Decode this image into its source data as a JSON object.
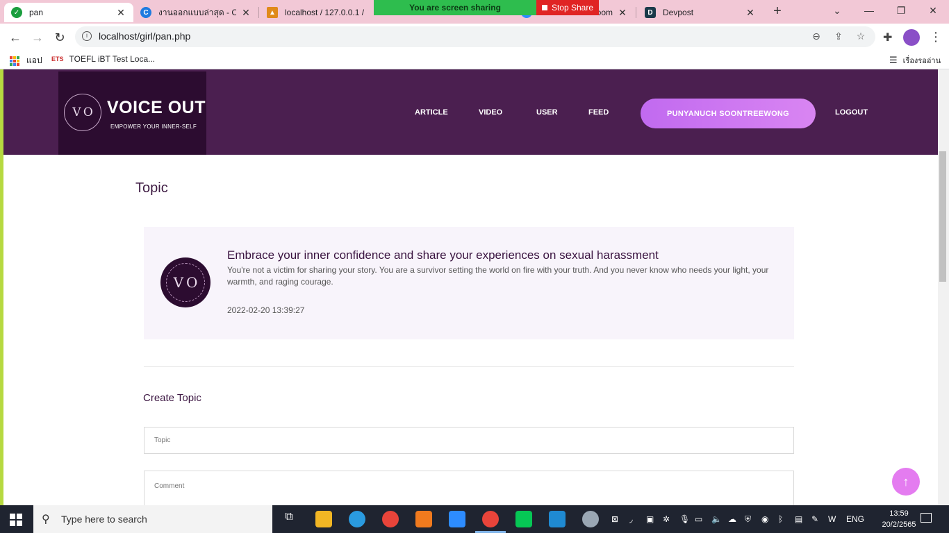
{
  "browser": {
    "tabs": [
      {
        "title": "pan",
        "favicon_color": "#1a9e3e",
        "active": true
      },
      {
        "title": "งานออกแบบล่าสุด - Canva",
        "favicon_color": "#1e7be0",
        "active": false
      },
      {
        "title": "localhost / 127.0.0.1 /",
        "favicon_color": "#e08a1a",
        "active": false
      },
      {
        "title": "",
        "favicon_color": "#2b7cd3",
        "active": false
      },
      {
        "title": "Zoom",
        "favicon_color": "#2d8cff",
        "active": false
      },
      {
        "title": "Devpost",
        "favicon_color": "#1a3a4a",
        "active": false
      }
    ],
    "share_banner": "You are screen sharing",
    "stop_share": "Stop Share",
    "url": "localhost/girl/pan.php",
    "bookmarks": {
      "apps": "แอป",
      "item1": "TOEFL iBT Test Loca...",
      "reading_list": "เรื่องรออ่าน"
    }
  },
  "site": {
    "logo": {
      "title": "VOICE OUT",
      "subtitle": "EMPOWER YOUR INNER-SELF",
      "badge": "V O"
    },
    "nav": {
      "article": "ARTICLE",
      "video": "VIDEO",
      "user": "USER",
      "feed": "FEED",
      "user_name": "PUNYANUCH SOONTREEWONG",
      "logout": "LOGOUT"
    },
    "page_title": "Topic",
    "topic": {
      "title": "Embrace your inner confidence and share your experiences on sexual harassment",
      "body": "You're not a victim for sharing your story. You are a survivor setting the world on fire with your truth. And you never know who needs your light, your warmth, and raging courage.",
      "date": "2022-02-20 13:39:27"
    },
    "create": {
      "title": "Create Topic",
      "topic_placeholder": "Topic",
      "comment_placeholder": "Comment"
    },
    "scroll_top_icon": "arrow-up-icon"
  },
  "taskbar": {
    "search_placeholder": "Type here to search",
    "language": "ENG",
    "time": "13:59",
    "date": "20/2/2565"
  },
  "colors": {
    "header": "#4b1f50",
    "logo_bg": "#2c0c30",
    "accent": "#d27ff2",
    "card_bg": "#f8f4fb"
  }
}
